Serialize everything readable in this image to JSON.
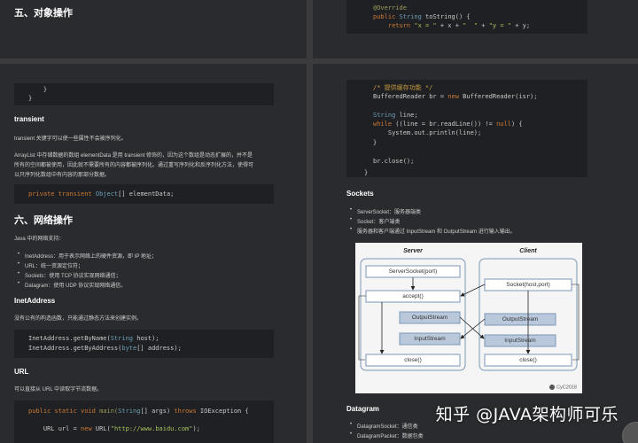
{
  "left_top": {
    "heading": "五、对象操作"
  },
  "left_bottom": {
    "code_brace": [
      "    }",
      "}"
    ],
    "transient_heading": "transient",
    "transient_p1": "transient 关键字可以使一些属性不会被序列化。",
    "transient_p2_l1": "ArrayList 中存储数据的数组 elementData 是用 transient 修饰的，因为这个数组是动态扩展的，并不是",
    "transient_p2_l2": "所有的空间都被使用，因此就不需要所有的内容都被序列化。通过重写序列化和反序列化方法，使得可",
    "transient_p2_l3": "以只序列化数组中有内容的那部分数据。",
    "transient_code": {
      "kw": "private transient ",
      "type": "Object",
      "rest": "[] elementData;"
    },
    "network_heading": "六、网络操作",
    "network_intro": "Java 中的网络支持：",
    "network_items": [
      "InetAddress：用于表示网络上的硬件资源，即 IP 地址；",
      "URL：统一资源定位符；",
      "Sockets：使用 TCP 协议实现网络通信；",
      "Datagram：使用 UDP 协议实现网络通信。"
    ],
    "inet_heading": "InetAddress",
    "inet_p": "没有公有的构造函数，只能通过静态方法来创建实例。",
    "inet_code": [
      {
        "a": "InetAddress.getByName(",
        "t": "String",
        "b": " host);"
      },
      {
        "a": "InetAddress.getByAddress(",
        "t": "byte",
        "b": "[] address);"
      }
    ],
    "url_heading": "URL",
    "url_p": "可以直接从 URL 中读取字节流数据。",
    "url_code_l1": {
      "kw": "public static void ",
      "fn": "main(",
      "t": "String",
      "b": "[] args) ",
      "kw2": "throws",
      "c": " IOException {"
    },
    "url_code_l2": {
      "a": "    URL url = ",
      "kw": "new",
      "b": " URL(",
      "s": "\"http://www.baidu.com\"",
      "c": ");"
    }
  },
  "right_top": {
    "annotation": "@Override",
    "l2": {
      "kw": "public ",
      "t": "String",
      "b": " toString() {"
    },
    "l3": {
      "kw": "    return ",
      "s1": "\"x = \"",
      "b": " + x + ",
      "s2": "\"  \"",
      "c": " + ",
      "s3": "\"y = \"",
      "d": " + y;"
    }
  },
  "right_bottom": {
    "code": [
      {
        "cm": "/* 提供缓存功能 */"
      },
      {
        "a": "BufferedReader br = ",
        "kw": "new",
        "b": " BufferedReader(isr);"
      },
      {
        "t": "String",
        "b": " line;"
      },
      {
        "kw": "while",
        "b": " ((line = br.readLine()) != ",
        "kw2": "null",
        "c": ") {"
      },
      {
        "b": "    System.out.println(line);"
      },
      {
        "b": "}"
      },
      {
        "b": "br.close();"
      },
      {
        "b": "}"
      }
    ],
    "sockets_heading": "Sockets",
    "sockets_items": [
      "ServerSocket：服务器端类",
      "Socket：客户端类",
      "服务器和客户端通过 InputStream 和 OutputStream 进行输入输出。"
    ],
    "diagram": {
      "server_title": "Server",
      "client_title": "Client",
      "server_boxes": [
        "ServerSocket(port)",
        "accept()",
        "OutputStream",
        "InputStream",
        "close()"
      ],
      "client_boxes": [
        "Socket(host,port)",
        "OutputStream",
        "InputStream",
        "close()"
      ],
      "credit": "CyC2018"
    },
    "datagram_heading": "Datagram",
    "datagram_items": [
      "DatagramSocket：通信类",
      "DatagramPacket：数据包类"
    ]
  },
  "watermark": "知乎 @JAVA架构师可乐",
  "colors": {
    "page_bg": "#3b3b3d",
    "panel_bg": "#2a2b2e",
    "code_bg": "#1f2023",
    "diagram_bg": "#f5f5f5",
    "box_border": "#7b96b8",
    "highlight_box": "#b9c9db"
  }
}
